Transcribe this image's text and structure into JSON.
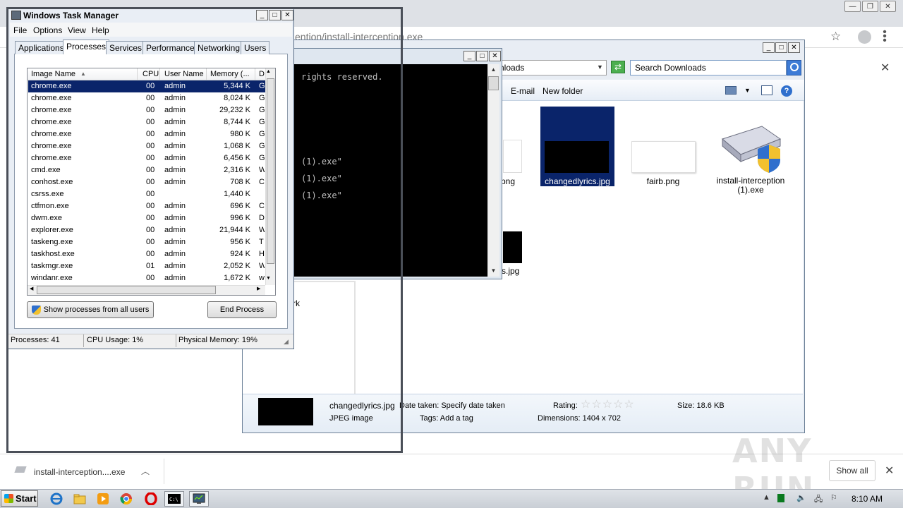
{
  "chrome": {
    "url_fragment": "ention/install-interception.exe",
    "window_controls": [
      "—",
      "❐",
      "✕"
    ]
  },
  "explorer": {
    "address": "nloads",
    "search_placeholder": "Search Downloads",
    "toolbar": {
      "email": "E-mail",
      "new_folder": "New folder"
    },
    "nav_partial": "rk",
    "files": [
      {
        "name": "png",
        "type": "partial"
      },
      {
        "name": "changedlyrics.jpg",
        "selected": true
      },
      {
        "name": "fairb.png"
      },
      {
        "name": "install-interception (1).exe"
      },
      {
        "name": "s.jpg",
        "type": "partial"
      }
    ],
    "details": {
      "filename": "changedlyrics.jpg",
      "filetype": "JPEG image",
      "date_taken": "Date taken: Specify date taken",
      "tags": "Tags: Add a tag",
      "rating_label": "Rating:",
      "stars": "☆☆☆☆☆",
      "dimensions": "Dimensions: 1404 x 702",
      "size": "Size: 18.6 KB"
    }
  },
  "cmd": {
    "lines": [
      "rights reserved.",
      "(1).exe\"",
      "(1).exe\"",
      "(1).exe\""
    ]
  },
  "taskmgr": {
    "title": "Windows Task Manager",
    "menu": [
      "File",
      "Options",
      "View",
      "Help"
    ],
    "tabs": [
      "Applications",
      "Processes",
      "Services",
      "Performance",
      "Networking",
      "Users"
    ],
    "active_tab": "Processes",
    "columns": [
      "Image Name",
      "CPU",
      "User Name",
      "Memory (...",
      "D"
    ],
    "rows": [
      [
        "chrome.exe",
        "00",
        "admin",
        "5,344 K",
        "G"
      ],
      [
        "chrome.exe",
        "00",
        "admin",
        "8,024 K",
        "G"
      ],
      [
        "chrome.exe",
        "00",
        "admin",
        "29,232 K",
        "G"
      ],
      [
        "chrome.exe",
        "00",
        "admin",
        "8,744 K",
        "G"
      ],
      [
        "chrome.exe",
        "00",
        "admin",
        "980 K",
        "G"
      ],
      [
        "chrome.exe",
        "00",
        "admin",
        "1,068 K",
        "G"
      ],
      [
        "chrome.exe",
        "00",
        "admin",
        "6,456 K",
        "G"
      ],
      [
        "cmd.exe",
        "00",
        "admin",
        "2,316 K",
        "W"
      ],
      [
        "conhost.exe",
        "00",
        "admin",
        "708 K",
        "C"
      ],
      [
        "csrss.exe",
        "00",
        "",
        "1,440 K",
        ""
      ],
      [
        "ctfmon.exe",
        "00",
        "admin",
        "696 K",
        "C"
      ],
      [
        "dwm.exe",
        "00",
        "admin",
        "996 K",
        "D"
      ],
      [
        "explorer.exe",
        "00",
        "admin",
        "21,944 K",
        "W"
      ],
      [
        "taskeng.exe",
        "00",
        "admin",
        "956 K",
        "T"
      ],
      [
        "taskhost.exe",
        "00",
        "admin",
        "924 K",
        "H"
      ],
      [
        "taskmgr.exe",
        "01",
        "admin",
        "2,052 K",
        "W"
      ],
      [
        "windanr.exe",
        "00",
        "admin",
        "1,672 K",
        "w"
      ]
    ],
    "show_all_button": "Show processes from all users",
    "end_process_button": "End Process",
    "status": {
      "processes": "Processes: 41",
      "cpu": "CPU Usage: 1%",
      "memory": "Physical Memory: 19%"
    }
  },
  "downloads_bar": {
    "file": "install-interception....exe",
    "show_all": "Show all"
  },
  "watermark": "ANY RUN",
  "taskbar": {
    "start": "Start",
    "time": "8:10 AM"
  }
}
